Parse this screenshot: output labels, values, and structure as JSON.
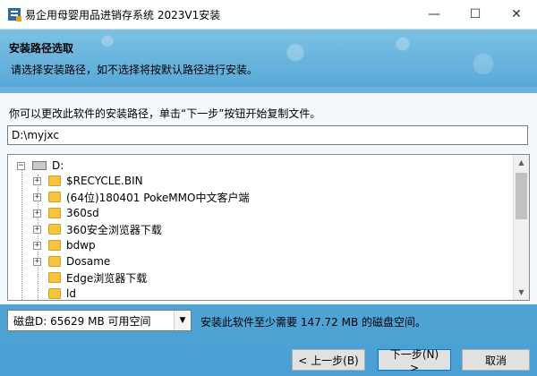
{
  "window": {
    "title": "易企用母婴用品进销存系统 2023V1安装",
    "minimize": "—",
    "maximize": "☐",
    "close": "✕"
  },
  "banner": {
    "title": "安装路径选取",
    "subtitle": "请选择安装路径，如不选择将按默认路径进行安装。"
  },
  "body": {
    "description": "你可以更改此软件的安装路径，单击“下一步”按钮开始复制文件。",
    "path_value": "D:\\myjxc",
    "tree": {
      "root": "D:",
      "items": [
        "$RECYCLE.BIN",
        "(64位)180401 PokeMMO中文客户端",
        "360sd",
        "360安全浏览器下载",
        "bdwp",
        "Dosame",
        "Edge浏览器下载",
        "ld"
      ],
      "expandable": [
        true,
        true,
        true,
        true,
        true,
        true,
        false,
        false
      ]
    },
    "drive_select": "磁盘D:   65629 MB 可用空间",
    "space_required": "安装此软件至少需要 147.72 MB 的磁盘空间。"
  },
  "buttons": {
    "back": "< 上一步(B)",
    "next": "下一步(N) >",
    "cancel": "取消"
  }
}
